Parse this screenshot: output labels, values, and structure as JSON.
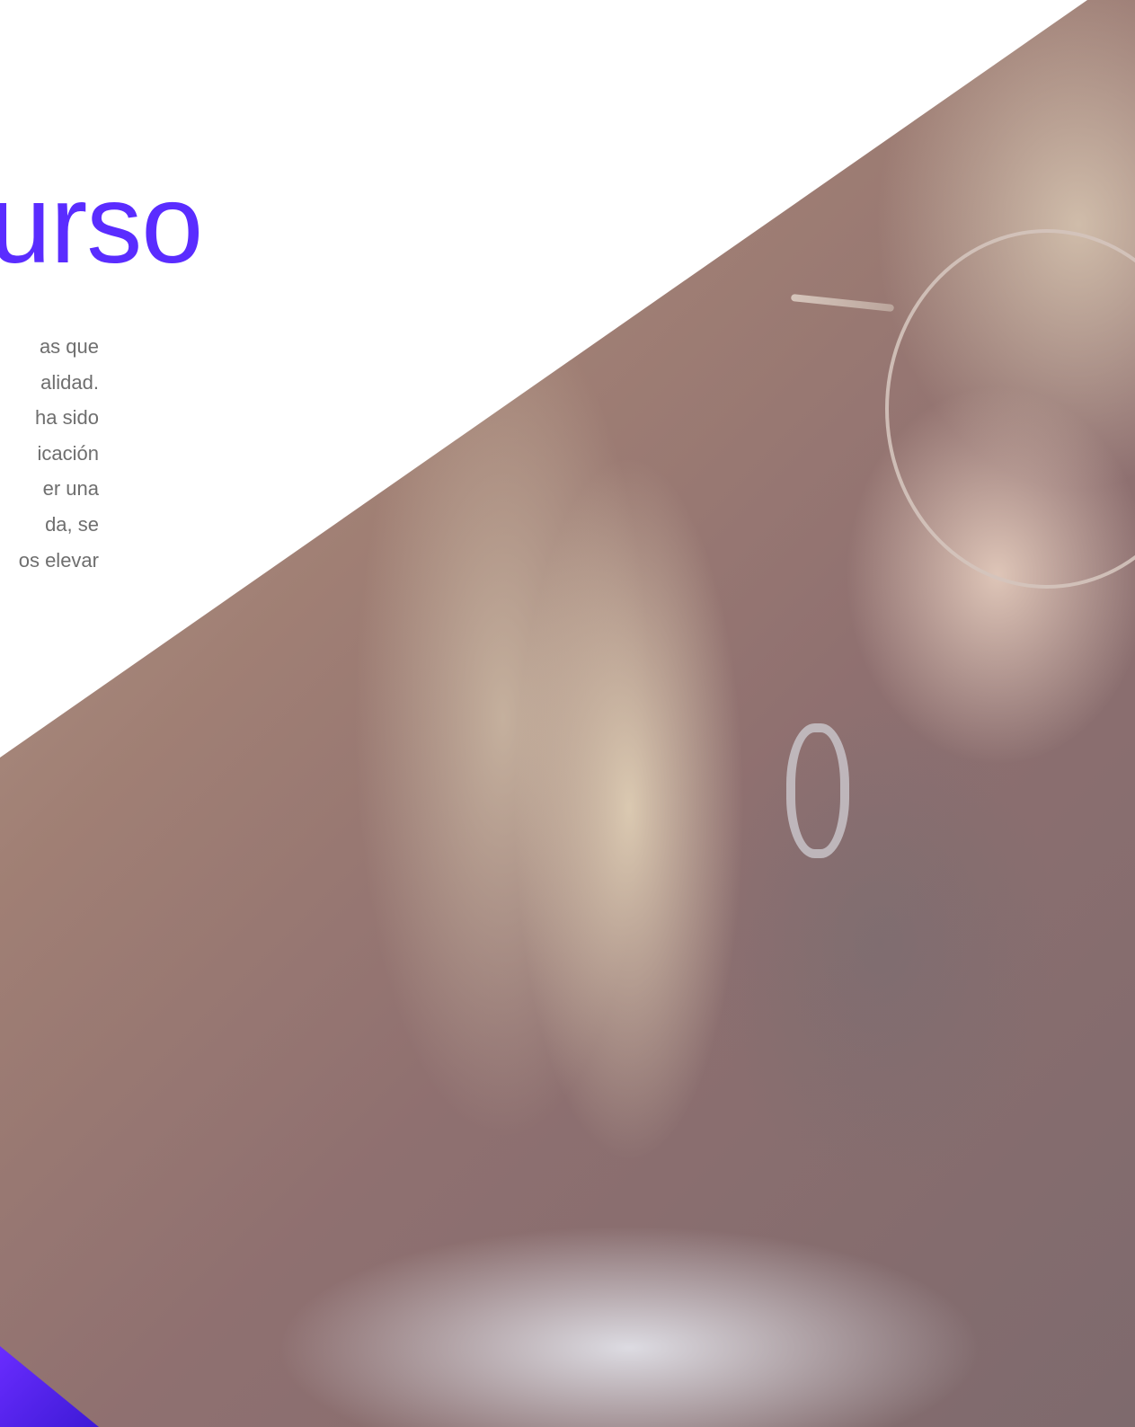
{
  "hero": {
    "title": "urso",
    "paragraph_lines": [
      "as que",
      "alidad.",
      "ha sido",
      "icación",
      "er una",
      "da, se",
      "os elevar"
    ],
    "accent_color": "#5a2cff"
  }
}
